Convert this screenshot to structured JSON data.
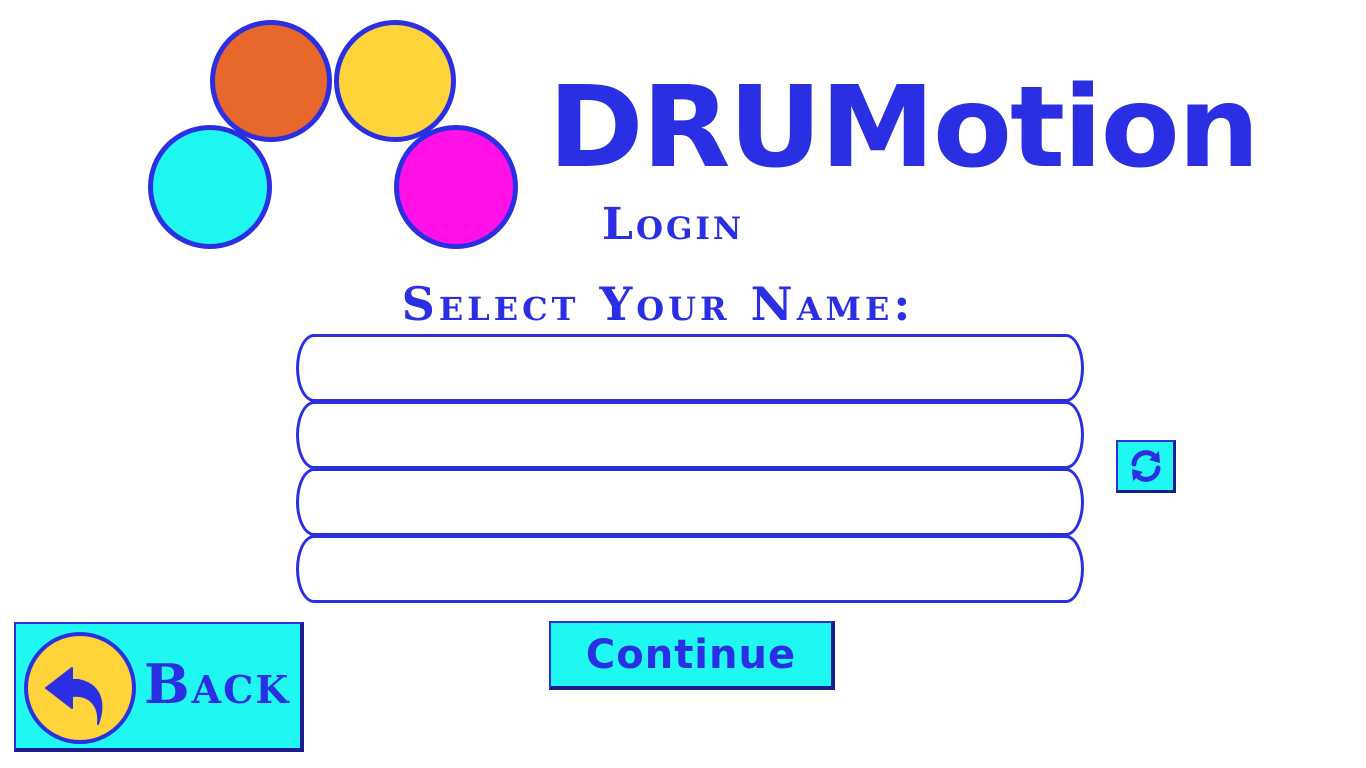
{
  "app": {
    "brand_name": "DRUMotion",
    "screen_title": "Login"
  },
  "logo": {
    "icon_name": "drumotion-logo",
    "colors": {
      "orange": "#e8672a",
      "yellow": "#ffd43b",
      "cyan": "#1ff7f2",
      "magenta": "#ff10e6",
      "outline": "#2b2fe3"
    }
  },
  "login": {
    "prompt": "Select Your Name:",
    "name_slots": [
      "",
      "",
      "",
      ""
    ],
    "refresh_icon": "refresh-icon",
    "continue_label": "Continue"
  },
  "navigation": {
    "back_label": "Back",
    "back_icon": "back-arrow-icon"
  },
  "theme": {
    "accent": "#2b2fe3",
    "button_bg": "#1ff7f2",
    "background": "#ffffff"
  }
}
